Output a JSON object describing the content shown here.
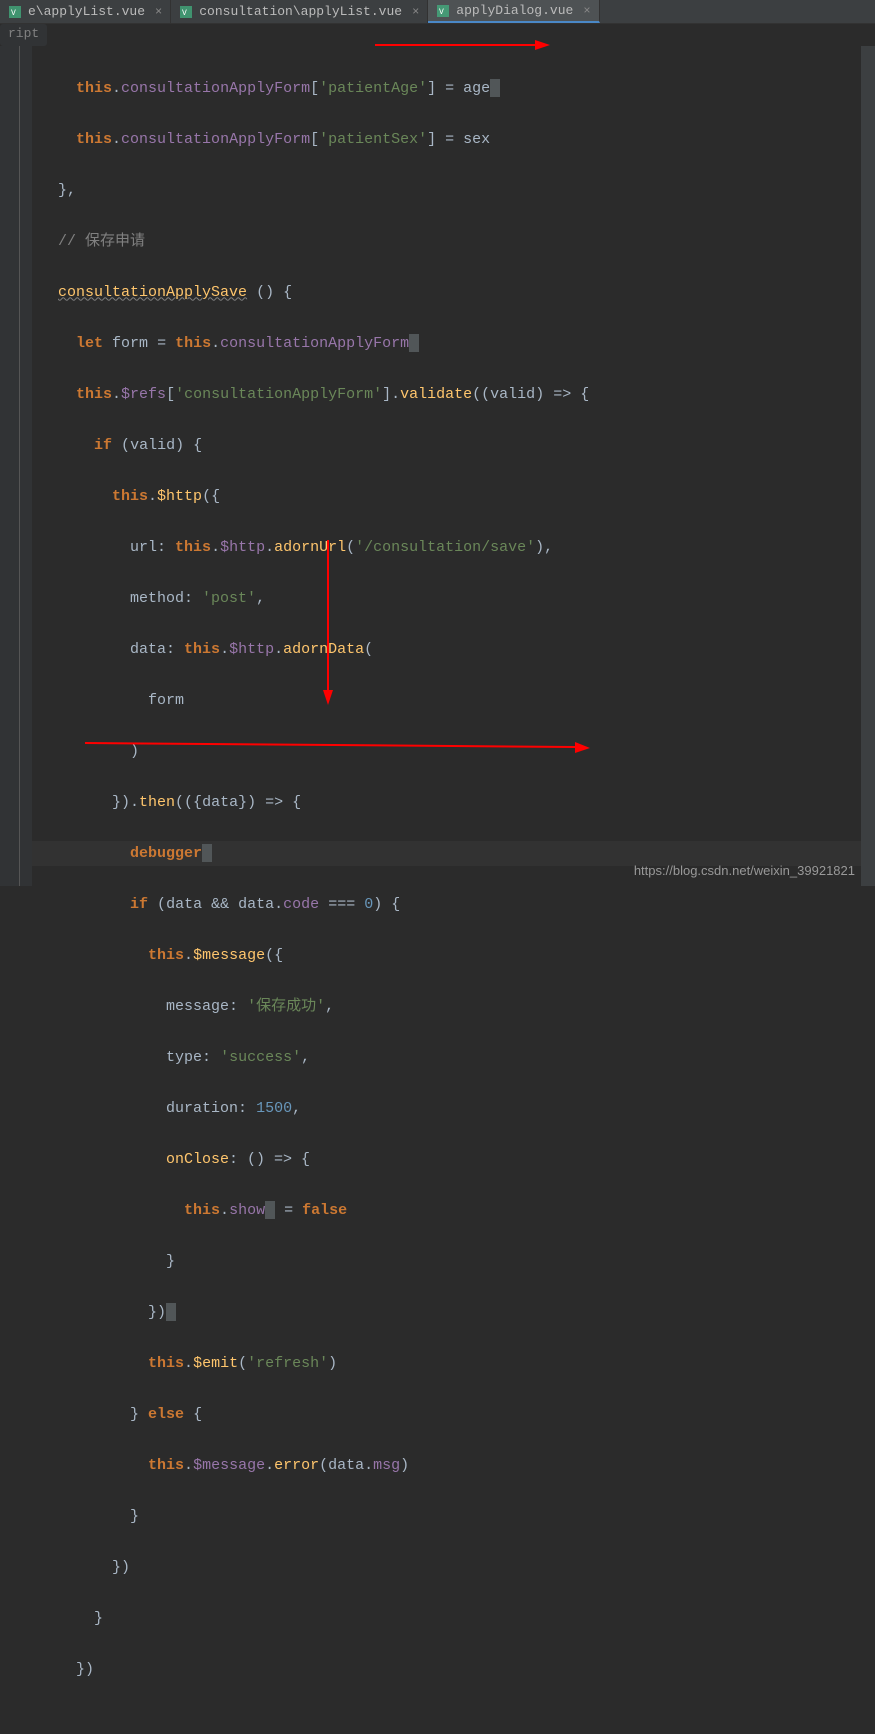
{
  "tabs": [
    {
      "label": "e\\applyList.vue",
      "active": false
    },
    {
      "label": "consultation\\applyList.vue",
      "active": false
    },
    {
      "label": "applyDialog.vue",
      "active": true
    }
  ],
  "breadcrumb": "ript",
  "code": {
    "c": {
      "save_apply": "// 保存申请"
    },
    "kw": {
      "this": "this",
      "let": "let",
      "if": "if",
      "else": "else",
      "debugger": "debugger",
      "false": "false"
    },
    "id": {
      "consultationApplyForm": "consultationApplyForm",
      "consultationApplySave": "consultationApplySave",
      "form": "form",
      "valid": "valid",
      "data": "data",
      "age": "age",
      "sex": "sex",
      "url": "url",
      "method": "method",
      "message": "message",
      "type": "type",
      "duration": "duration",
      "onClose": "onClose",
      "show": "show",
      "code": "code",
      "msg": "msg"
    },
    "fn": {
      "validate": "validate",
      "$http": "$http",
      "adornUrl": "adornUrl",
      "adornData": "adornData",
      "then": "then",
      "$message": "$message",
      "$emit": "$emit",
      "error": "error",
      "$refs": "$refs"
    },
    "str": {
      "patientAge": "'patientAge'",
      "patientSex": "'patientSex'",
      "consultationApplyForm": "'consultationApplyForm'",
      "save_url": "'/consultation/save'",
      "post": "'post'",
      "save_success": "'保存成功'",
      "success": "'success'",
      "refresh": "'refresh'"
    },
    "num": {
      "zero": "0",
      "n1500": "1500"
    }
  },
  "watermark": "https://blog.csdn.net/weixin_39921821"
}
